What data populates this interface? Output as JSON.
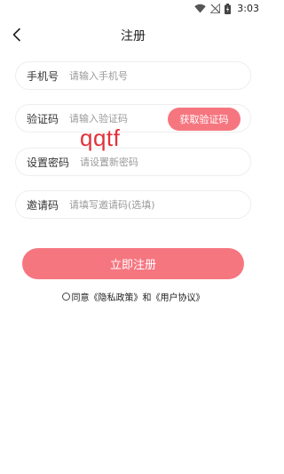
{
  "status_bar": {
    "time": "3:03",
    "icons": [
      "wifi-icon",
      "no-signal-icon",
      "battery-icon"
    ]
  },
  "header": {
    "title": "注册",
    "back_icon": "chevron-left-icon"
  },
  "form": {
    "phone": {
      "label": "手机号",
      "placeholder": "请输入手机号",
      "value": ""
    },
    "code": {
      "label": "验证码",
      "placeholder": "请输入验证码",
      "value": "",
      "button_label": "获取验证码"
    },
    "password": {
      "label": "设置密码",
      "placeholder": "请设置新密码",
      "value": ""
    },
    "invite": {
      "label": "邀请码",
      "placeholder": "请填写邀请码(选填)",
      "value": ""
    }
  },
  "watermark": "qqtf",
  "register_button": "立即注册",
  "agreement": {
    "prefix": "同意",
    "privacy_link": "《隐私政策》",
    "and": "和",
    "terms_link": "《用户协议》",
    "checked": false
  },
  "colors": {
    "accent": "#f67680",
    "watermark": "#e2323a",
    "field_border": "#eeeeee",
    "placeholder": "#9a9a9a"
  }
}
